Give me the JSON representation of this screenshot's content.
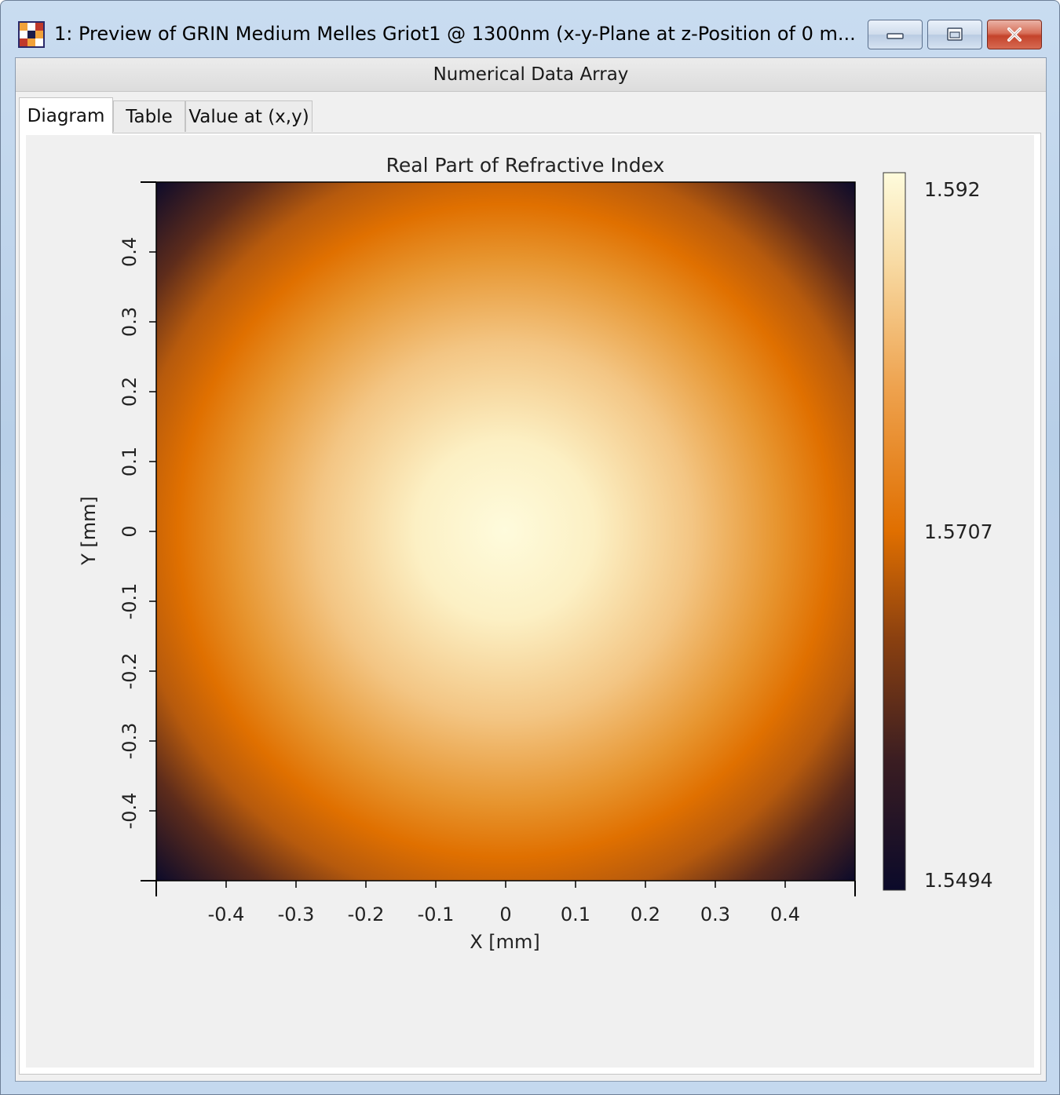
{
  "window": {
    "title": "1: Preview of GRIN Medium Melles Griot1 @ 1300nm (x-y-Plane at z-Position of 0 m...",
    "icon": "checkered-app-icon",
    "controls": [
      "minimize-icon",
      "maximize-icon",
      "close-icon"
    ]
  },
  "header": {
    "label": "Numerical Data Array"
  },
  "tabs": [
    {
      "label": "Diagram",
      "active": true
    },
    {
      "label": "Table",
      "active": false
    },
    {
      "label": "Value at (x,y)",
      "active": false
    }
  ],
  "chart_data": {
    "type": "heatmap",
    "title": "Real Part of Refractive Index",
    "xlabel": "X [mm]",
    "ylabel": "Y [mm]",
    "xlim": [
      -0.5,
      0.5
    ],
    "ylim": [
      -0.5,
      0.5
    ],
    "x_ticks": [
      "-0.4",
      "-0.3",
      "-0.2",
      "-0.1",
      "0",
      "0.1",
      "0.2",
      "0.3",
      "0.4"
    ],
    "y_ticks": [
      "-0.4",
      "-0.3",
      "-0.2",
      "-0.1",
      "0",
      "0.1",
      "0.2",
      "0.3",
      "0.4"
    ],
    "colorbar": {
      "min": 1.5494,
      "mid": 1.5707,
      "max": 1.592,
      "labels": [
        "1.592",
        "1.5707",
        "1.5494"
      ],
      "colors": [
        "#0b0a2a",
        "#3a1d22",
        "#8a4010",
        "#e06f00",
        "#eea24e",
        "#f8dca6",
        "#fefbdc"
      ]
    },
    "field": {
      "center": [
        0,
        0
      ],
      "peak_value": 1.592,
      "corner_value": 1.5494,
      "profile": "radially decreasing (parabolic GRIN)"
    }
  }
}
